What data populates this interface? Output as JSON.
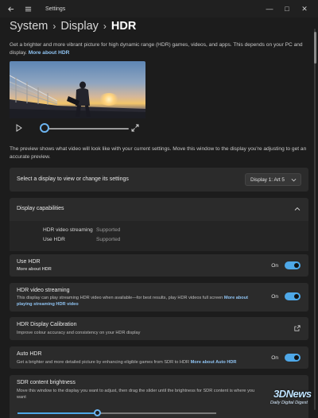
{
  "window": {
    "title": "Settings",
    "controls": {
      "minimize": "—",
      "maximize": "□",
      "close": "✕"
    }
  },
  "breadcrumb": {
    "items": [
      "System",
      "Display"
    ],
    "current": "HDR"
  },
  "intro": {
    "text": "Get a brighter and more vibrant picture for high dynamic range (HDR) games, videos, and apps. This depends on your PC and display. ",
    "link": "More about HDR"
  },
  "preview_player": {
    "icons": [
      "play-icon",
      "expand-icon"
    ],
    "progress": 0.05
  },
  "preview_note": "The preview shows what video will look like with your current settings. Move this window to the display you're adjusting to get an accurate preview.",
  "select_display": {
    "label": "Select a display to view or change its settings",
    "selected": "Display 1: Art 5"
  },
  "capabilities": {
    "title": "Display capabilities",
    "rows": [
      {
        "label": "HDR video streaming",
        "value": "Supported"
      },
      {
        "label": "Use HDR",
        "value": "Supported"
      }
    ]
  },
  "use_hdr": {
    "title": "Use HDR",
    "link": "More about HDR",
    "state": "On"
  },
  "hdr_video": {
    "title": "HDR video streaming",
    "desc": "This display can play streaming HDR video when available—for best results, play HDR videos full screen ",
    "link": "More about playing streaming HDR video",
    "state": "On"
  },
  "calibration": {
    "title": "HDR Display Calibration",
    "desc": "Improve colour accuracy and consistency on your HDR display"
  },
  "auto_hdr": {
    "title": "Auto HDR",
    "desc": "Get a brighter and more detailed picture by enhancing eligible games from SDR to HDR ",
    "link": "More about Auto HDR",
    "state": "On"
  },
  "sdr_brightness": {
    "title": "SDR content brightness",
    "desc": "Move this window to the display you want to adjust, then drag the slider until the brightness for SDR content is where you want",
    "value": 0.4
  },
  "watermark": {
    "main": "3DNews",
    "sub": "Daily Digital Digest"
  },
  "colors": {
    "accent": "#4ea8e8",
    "link": "#8fc3f2",
    "card": "#2b2b2b",
    "background": "#1c1c1c"
  }
}
